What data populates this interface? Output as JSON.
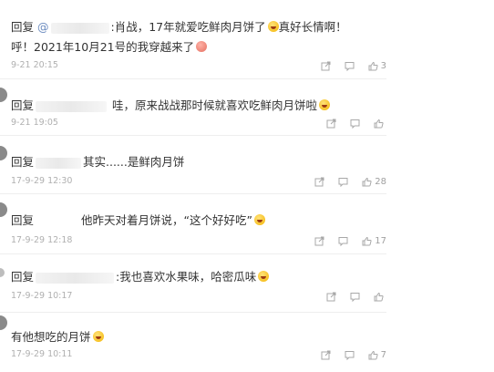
{
  "comments": [
    {
      "prefix": "回复",
      "mention": "@",
      "body": ":肖战，17年就爱吃鲜肉月饼了",
      "body_line1_tail": "真好长情啊！",
      "body_line2": "呼！2021年10月21号的我穿越来了",
      "time": "9-21 20:15",
      "likes": "3"
    },
    {
      "prefix": "回复",
      "body": "哇，原来战战那时候就喜欢吃鲜肉月饼啦",
      "time": "9-21 19:05",
      "likes": ""
    },
    {
      "prefix": "回复",
      "body": "其实......是鲜肉月饼",
      "time": "17-9-29 12:30",
      "likes": "28"
    },
    {
      "prefix": "回复",
      "body": "他昨天对着月饼说，“这个好好吃”",
      "time": "17-9-29 12:18",
      "likes": "17"
    },
    {
      "prefix": "回复",
      "body": ":我也喜欢水果味，哈密瓜味",
      "time": "17-9-29 10:17",
      "likes": ""
    },
    {
      "prefix": "",
      "body": "有他想吃的月饼",
      "time": "17-9-29 10:11",
      "likes": "7"
    }
  ],
  "icons": {
    "share": "share-icon",
    "comment": "comment-icon",
    "like": "thumbs-up-icon"
  },
  "colors": {
    "mention": "#6b8bbf",
    "timestamp": "#b0b0b0",
    "action": "#a0a0a0"
  }
}
